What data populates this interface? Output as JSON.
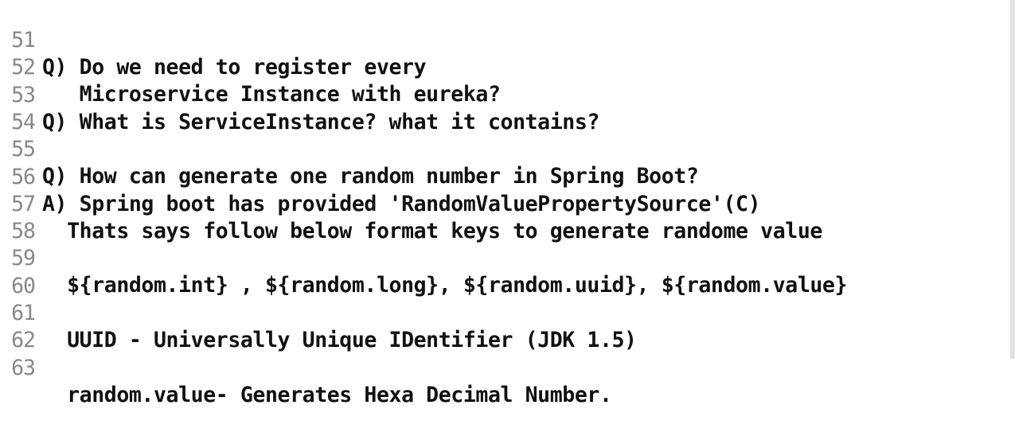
{
  "lines": [
    {
      "number": "51",
      "text": "Q) Do we need to register every"
    },
    {
      "number": "52",
      "text": "   Microservice Instance with eureka?"
    },
    {
      "number": "53",
      "text": "Q) What is ServiceInstance? what it contains?"
    },
    {
      "number": "54",
      "text": ""
    },
    {
      "number": "55",
      "text": "Q) How can generate one random number in Spring Boot?"
    },
    {
      "number": "56",
      "text": "A) Spring boot has provided 'RandomValuePropertySource'(C)"
    },
    {
      "number": "57",
      "text": "  Thats says follow below format keys to generate randome value"
    },
    {
      "number": "58",
      "text": ""
    },
    {
      "number": "59",
      "text": "  ${random.int} , ${random.long}, ${random.uuid}, ${random.value}"
    },
    {
      "number": "60",
      "text": ""
    },
    {
      "number": "61",
      "text": "  UUID - Universally Unique IDentifier (JDK 1.5)"
    },
    {
      "number": "62",
      "text": ""
    },
    {
      "number": "63",
      "text": "  random.value- Generates Hexa Decimal Number."
    }
  ]
}
